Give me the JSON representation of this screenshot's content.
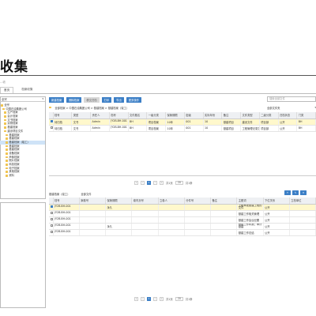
{
  "page": {
    "title": "收集",
    "sub_crumb": "…收"
  },
  "top_tabs": [
    {
      "label": "首页"
    },
    {
      "label": "档案收集"
    }
  ],
  "tree": {
    "selected": "全宗",
    "items": [
      {
        "label": "全宗"
      },
      {
        "label": "中国石油集团公司"
      },
      {
        "label": "生产档案"
      },
      {
        "label": "会计档案"
      },
      {
        "label": "文书档案"
      },
      {
        "label": "实物档案"
      },
      {
        "label": "基建档案"
      },
      {
        "label": "建设项目文件"
      },
      {
        "label": "基建档案"
      },
      {
        "label": "基建档案"
      },
      {
        "label": "基建档案（竣工）"
      },
      {
        "label": "基建档案"
      },
      {
        "label": "基建档案"
      },
      {
        "label": "设备档案"
      },
      {
        "label": "声像档案"
      },
      {
        "label": "照片档案"
      },
      {
        "label": "科技档案"
      },
      {
        "label": "电子档案"
      },
      {
        "label": "其他档案"
      },
      {
        "label": "资料"
      }
    ]
  },
  "toolbar": {
    "buttons": [
      {
        "label": "新建档案"
      },
      {
        "label": "删除档案"
      },
      {
        "label": "移交归档"
      },
      {
        "label": "打印"
      },
      {
        "label": "导出"
      },
      {
        "label": "更多操作"
      }
    ],
    "search_placeholder": "搜索全部文件"
  },
  "crumbs": {
    "path": "全部档案 > 中国石油集团公司 > 基建档案 > 基建档案（竣工）",
    "folder_select": "全部文件夹"
  },
  "top_table": {
    "headers": [
      "",
      "档号",
      "类型",
      "责任人",
      "档号",
      "文件题名",
      "一级分类",
      "保管期限",
      "密级",
      "实际年份",
      "备注",
      "文件类型",
      "二级分类",
      "归档状态",
      "门类"
    ],
    "rows": [
      {
        "cells": [
          "",
          "待归档",
          "文书",
          "Admin",
          "JY2B-BH-001",
          "BH",
          "项目档案",
          "10年",
          "001",
          "10",
          "基建项目",
          "建设文件",
          "项目部",
          "公开",
          "BH"
        ],
        "selected": true
      },
      {
        "cells": [
          "",
          "待归档",
          "文书",
          "Admin",
          "JY2B-BH-001",
          "BH",
          "项目档案",
          "10年",
          "001",
          "10",
          "基建项目",
          "工程管理记录文件",
          "项目部",
          "公开",
          "BH"
        ],
        "selected": false
      }
    ]
  },
  "pager": {
    "first": "«",
    "prev": "‹",
    "page": "1",
    "next": "›",
    "last": "»",
    "total_text": "共1页",
    "page_size": "20",
    "summary": "共1条"
  },
  "lower_bar": {
    "select_label": "基建档案（竣工）",
    "select_hint": "全部文件"
  },
  "lower_icons": [
    "+",
    "✎",
    "✕"
  ],
  "bottom_table": {
    "headers": [
      "",
      "档号",
      "案卷号",
      "保管期限",
      "卷内页号",
      "立卷人",
      "分件号",
      "备注",
      "主题词",
      "下位关系",
      "立档单位"
    ],
    "rows": [
      {
        "cells": [
          "",
          "JY2B-BH-001",
          "",
          "永久",
          "",
          "",
          "",
          "",
          "上级审批基建工程的文件",
          "公开",
          ""
        ],
        "selected": true
      },
      {
        "cells": [
          "",
          "JY2B-BH-001",
          "",
          "",
          "",
          "",
          "",
          "",
          "基建工作相关管理",
          "公开",
          ""
        ],
        "selected": false
      },
      {
        "cells": [
          "",
          "JY2B-BH-001",
          "",
          "",
          "",
          "",
          "",
          "",
          "基建工作会议纪要",
          "公开",
          ""
        ],
        "selected": false
      },
      {
        "cells": [
          "",
          "JY2B-BH-001",
          "",
          "永久",
          "",
          "",
          "",
          "",
          "基建工作年报；审计基建",
          "公开",
          ""
        ],
        "selected": false
      },
      {
        "cells": [
          "",
          "JY2B-BH-001",
          "",
          "",
          "",
          "",
          "",
          "",
          "基建工作总结",
          "公开",
          ""
        ],
        "selected": false
      }
    ]
  },
  "colors": {
    "accent": "#3c7fc6",
    "selected_row": "#fff8cc",
    "tree_selected": "#cfe3f7"
  }
}
